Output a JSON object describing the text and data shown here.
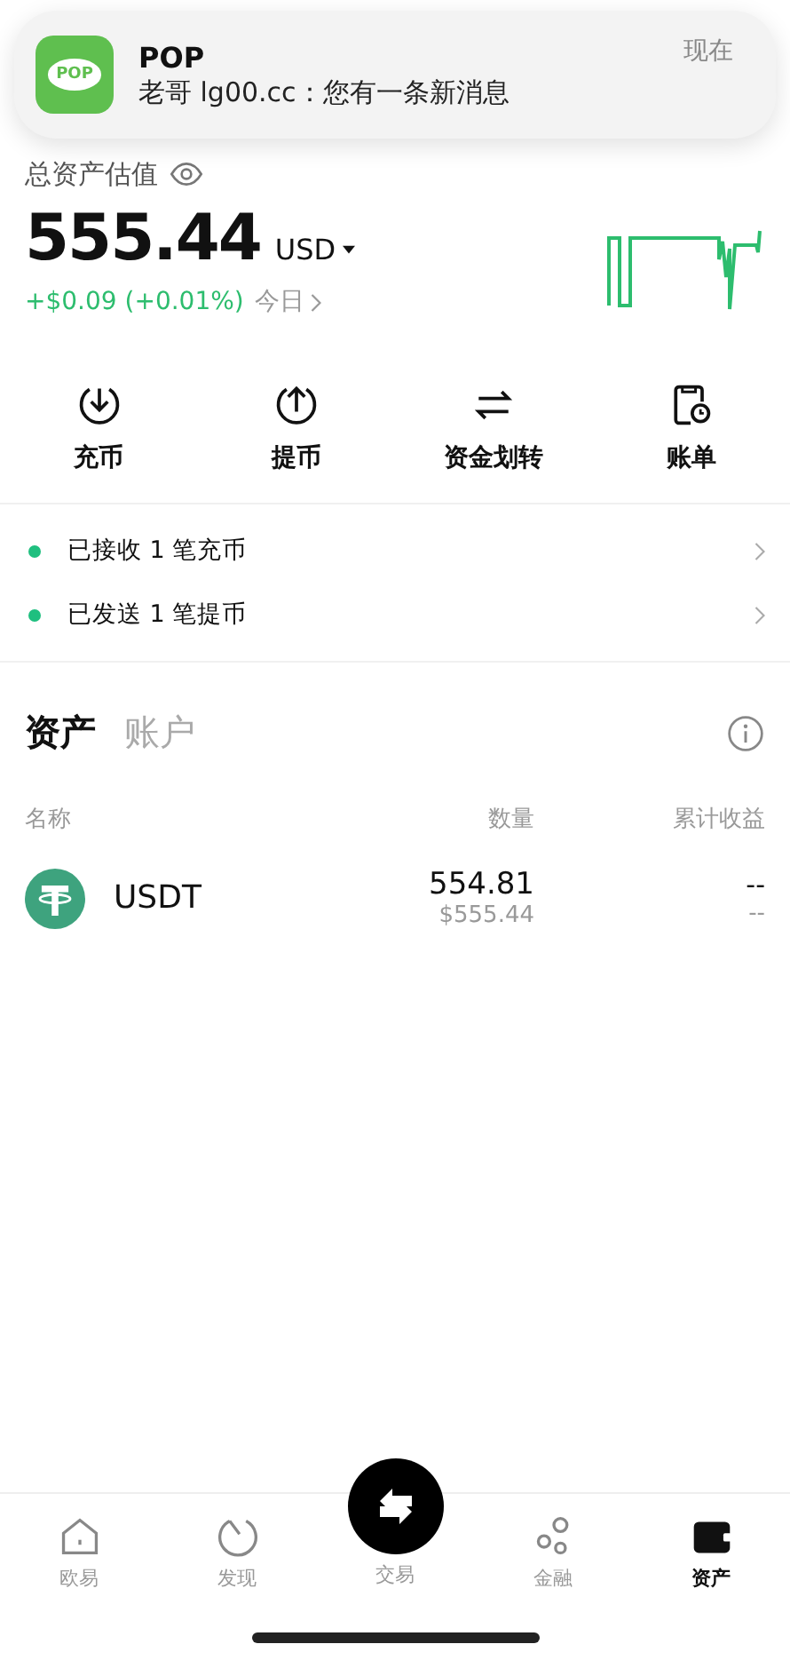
{
  "notification": {
    "app": "POP",
    "app_icon_text": "POP",
    "message": "老哥 lg00.cc：您有一条新消息",
    "time": "现在"
  },
  "summary": {
    "label": "总资产估值",
    "amount": "555.44",
    "currency": "USD",
    "change": "+$0.09 (+0.01%)",
    "period": "今日"
  },
  "actions": [
    {
      "label": "充币"
    },
    {
      "label": "提币"
    },
    {
      "label": "资金划转"
    },
    {
      "label": "账单"
    }
  ],
  "notices": [
    {
      "text": "已接收 1 笔充币",
      "color": "#1fbf7f"
    },
    {
      "text": "已发送 1 笔提币",
      "color": "#1fbf7f"
    }
  ],
  "asset_tabs": [
    {
      "label": "资产",
      "selected": true
    },
    {
      "label": "账户",
      "selected": false
    }
  ],
  "table": {
    "columns": [
      "名称",
      "数量",
      "累计收益"
    ],
    "rows": [
      {
        "coin": "USDT",
        "amount": "554.81",
        "value": "$555.44",
        "pnl": "--",
        "pnl_sub": "--"
      }
    ]
  },
  "bottom_nav": [
    {
      "label": "欧易",
      "selected": false
    },
    {
      "label": "发现",
      "selected": false
    },
    {
      "label": "交易",
      "selected": false
    },
    {
      "label": "金融",
      "selected": false
    },
    {
      "label": "资产",
      "selected": true
    }
  ]
}
